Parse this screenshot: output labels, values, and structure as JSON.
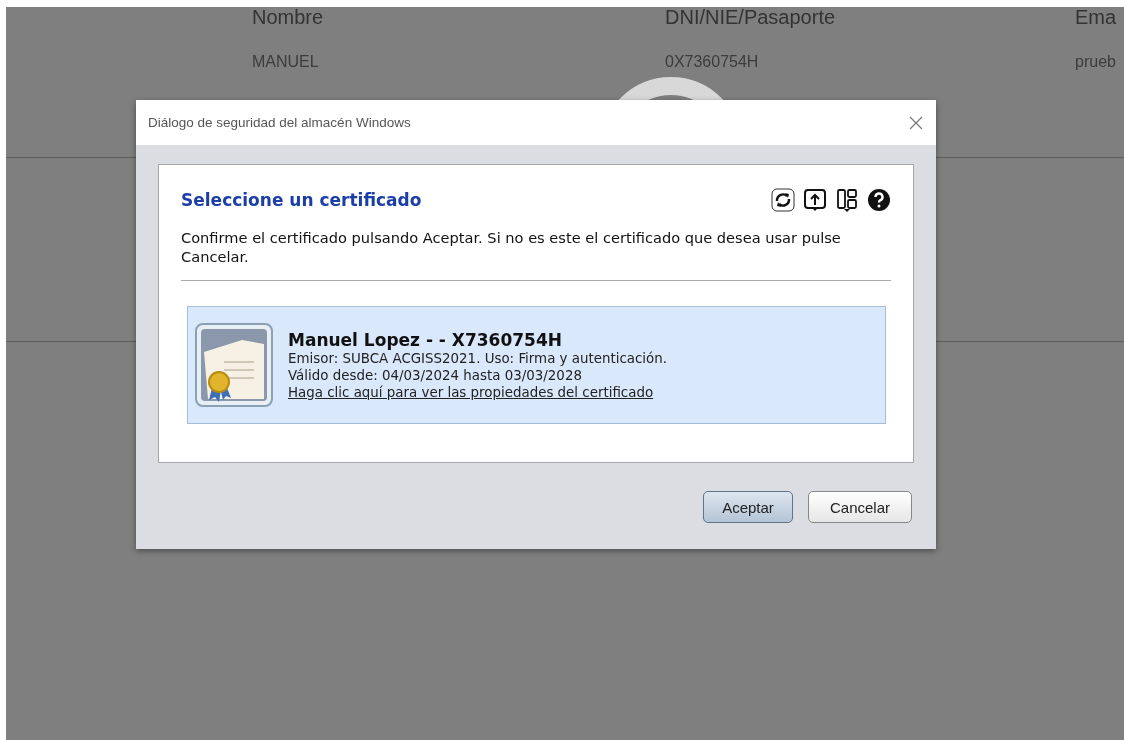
{
  "background_page": {
    "columns": [
      "Nombre",
      "DNI/NIE/Pasaporte",
      "Ema"
    ],
    "row": [
      "MANUEL",
      "0X7360754H",
      "prueb"
    ]
  },
  "dialog": {
    "title": "Diálogo de seguridad del almacén Windows",
    "heading": "Seleccione un certificado",
    "message": "Confirme el certificado pulsando Aceptar. Si no es este el certificado que desea usar pulse Cancelar.",
    "certificates": [
      {
        "name": "Manuel Lopez - - X7360754H",
        "issuer": "Emisor: SUBCA ACGISS2021. Uso: Firma y autenticación.",
        "validity": "Válido desde: 04/03/2024 hasta 03/03/2028",
        "link": "Haga clic aquí para ver las propiedades del certificado",
        "selected": true
      }
    ],
    "buttons": [
      {
        "label": "Aceptar",
        "default": true
      },
      {
        "label": "Cancelar",
        "default": false
      }
    ]
  }
}
